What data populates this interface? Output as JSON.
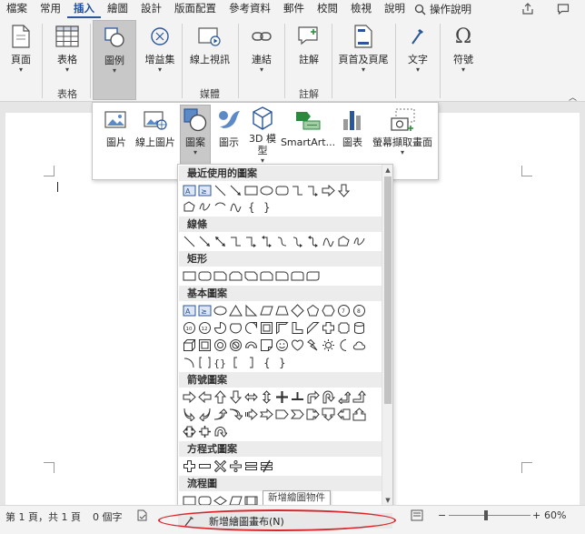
{
  "tabs": [
    "檔案",
    "常用",
    "插入",
    "繪圖",
    "設計",
    "版面配置",
    "參考資料",
    "郵件",
    "校閱",
    "檢視",
    "說明"
  ],
  "active_tab": "插入",
  "tell_me": "操作說明",
  "ribbon": {
    "pages": "頁面",
    "table": "表格",
    "illustrations": "圖例",
    "addins": "增益集",
    "online_video": "線上視訊",
    "links": "連結",
    "comment": "註解",
    "header_footer": "頁首及頁尾",
    "text": "文字",
    "symbols": "符號",
    "groups": {
      "tables": "表格",
      "media": "媒體",
      "comments": "註解"
    }
  },
  "illustrations": {
    "pictures": "圖片",
    "online_pictures": "線上圖片",
    "shapes": "圖案",
    "icons": "圖示",
    "models_3d_line1": "3D 模",
    "models_3d_line2": "型",
    "smartart": "SmartArt...",
    "chart": "圖表",
    "screenshot": "螢幕擷取畫面"
  },
  "shapes_gallery": {
    "categories": {
      "recent": "最近使用的圖案",
      "lines": "線條",
      "rectangles": "矩形",
      "basic": "基本圖案",
      "arrows": "箭號圖案",
      "equation": "方程式圖案",
      "flowchart": "流程圖"
    },
    "new_canvas": "新增繪圖畫布(N)",
    "tooltip": "新增繪圖物件"
  },
  "status": {
    "page": "第 1 頁，共 1 頁",
    "words": "0 個字",
    "zoom": "60%"
  },
  "colors": {
    "accent": "#2b579a",
    "highlight": "#d9262b"
  }
}
